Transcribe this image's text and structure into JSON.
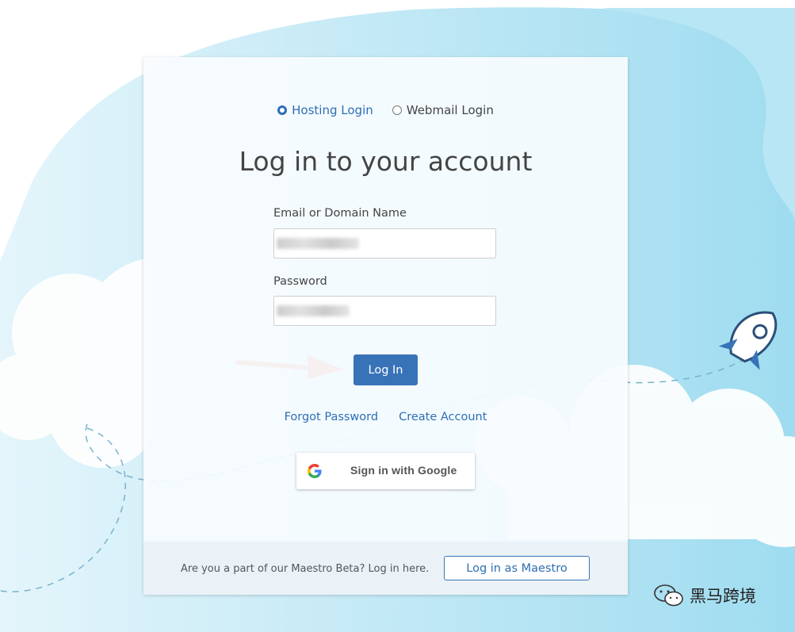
{
  "login_type": {
    "options": [
      {
        "label": "Hosting Login",
        "selected": true
      },
      {
        "label": "Webmail Login",
        "selected": false
      }
    ]
  },
  "heading": "Log in to your account",
  "email": {
    "label": "Email or Domain Name",
    "value": ""
  },
  "password": {
    "label": "Password",
    "value": ""
  },
  "login_button": "Log In",
  "links": {
    "forgot": "Forgot Password",
    "create": "Create Account"
  },
  "google_button": "Sign in with Google",
  "footer": {
    "question": "Are you a part of our Maestro Beta? Log in here.",
    "maestro_button": "Log in as Maestro"
  },
  "watermark": "黑马跨境",
  "colors": {
    "accent": "#3873b8",
    "link": "#2e6eb5",
    "sky": "#a8dff0",
    "arrow": "#f0574c"
  },
  "icons": [
    "google-icon",
    "rocket-icon",
    "wechat-icon",
    "arrow-icon"
  ]
}
